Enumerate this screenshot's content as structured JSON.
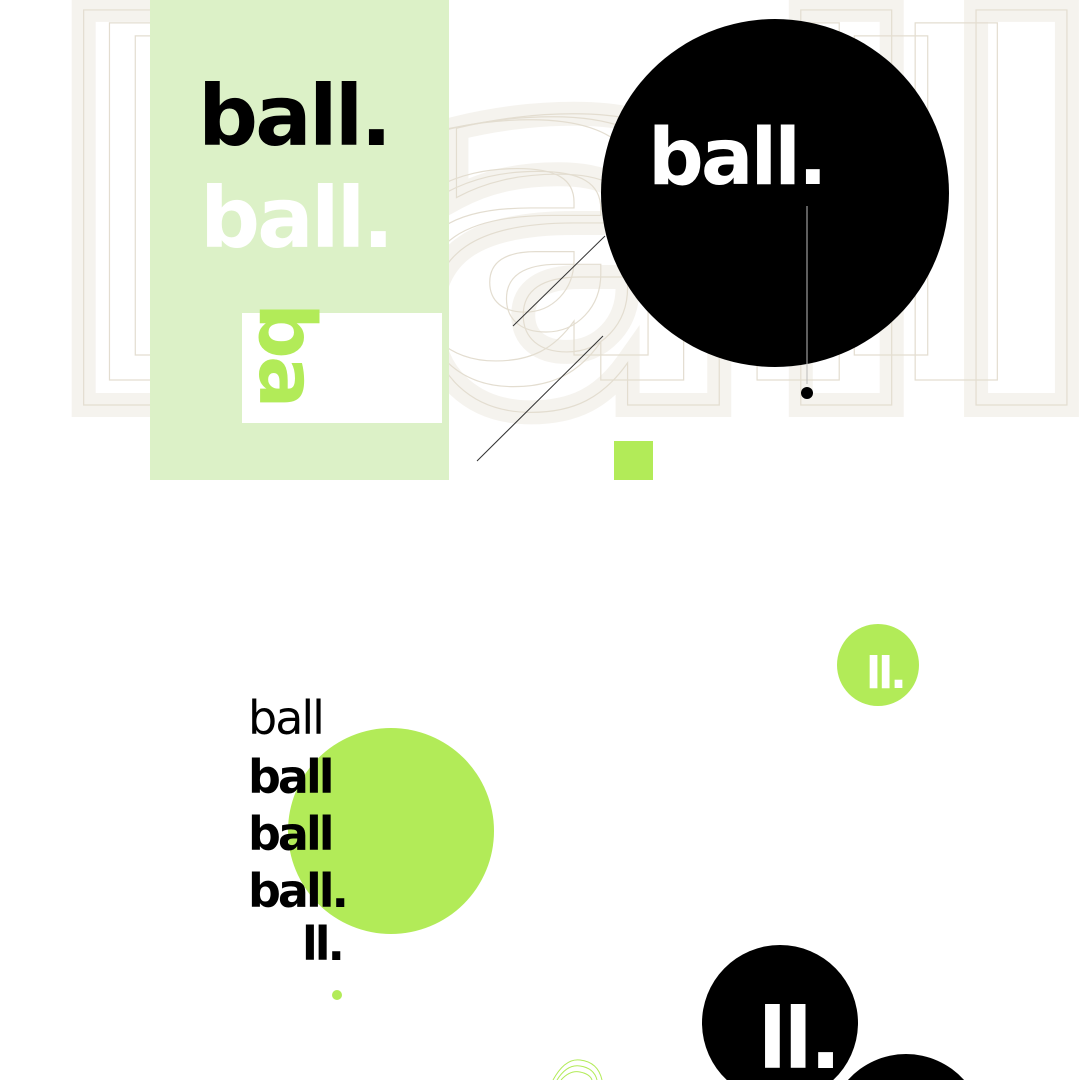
{
  "colors": {
    "accent": "#b2eb58",
    "pale_green": "#dcf1c7",
    "black": "#000000",
    "outline": "#e3ddd0"
  },
  "background_wordmark": "ball",
  "panel": {
    "logo_dark": "ball.",
    "logo_light": "ball.",
    "rotated_fragment": "ba"
  },
  "black_circle_logo": "ball.",
  "green_badge": "ll.",
  "weight_stack": [
    "ball",
    "ball",
    "ball",
    "ball.",
    "ll."
  ],
  "black_badge": "ll."
}
